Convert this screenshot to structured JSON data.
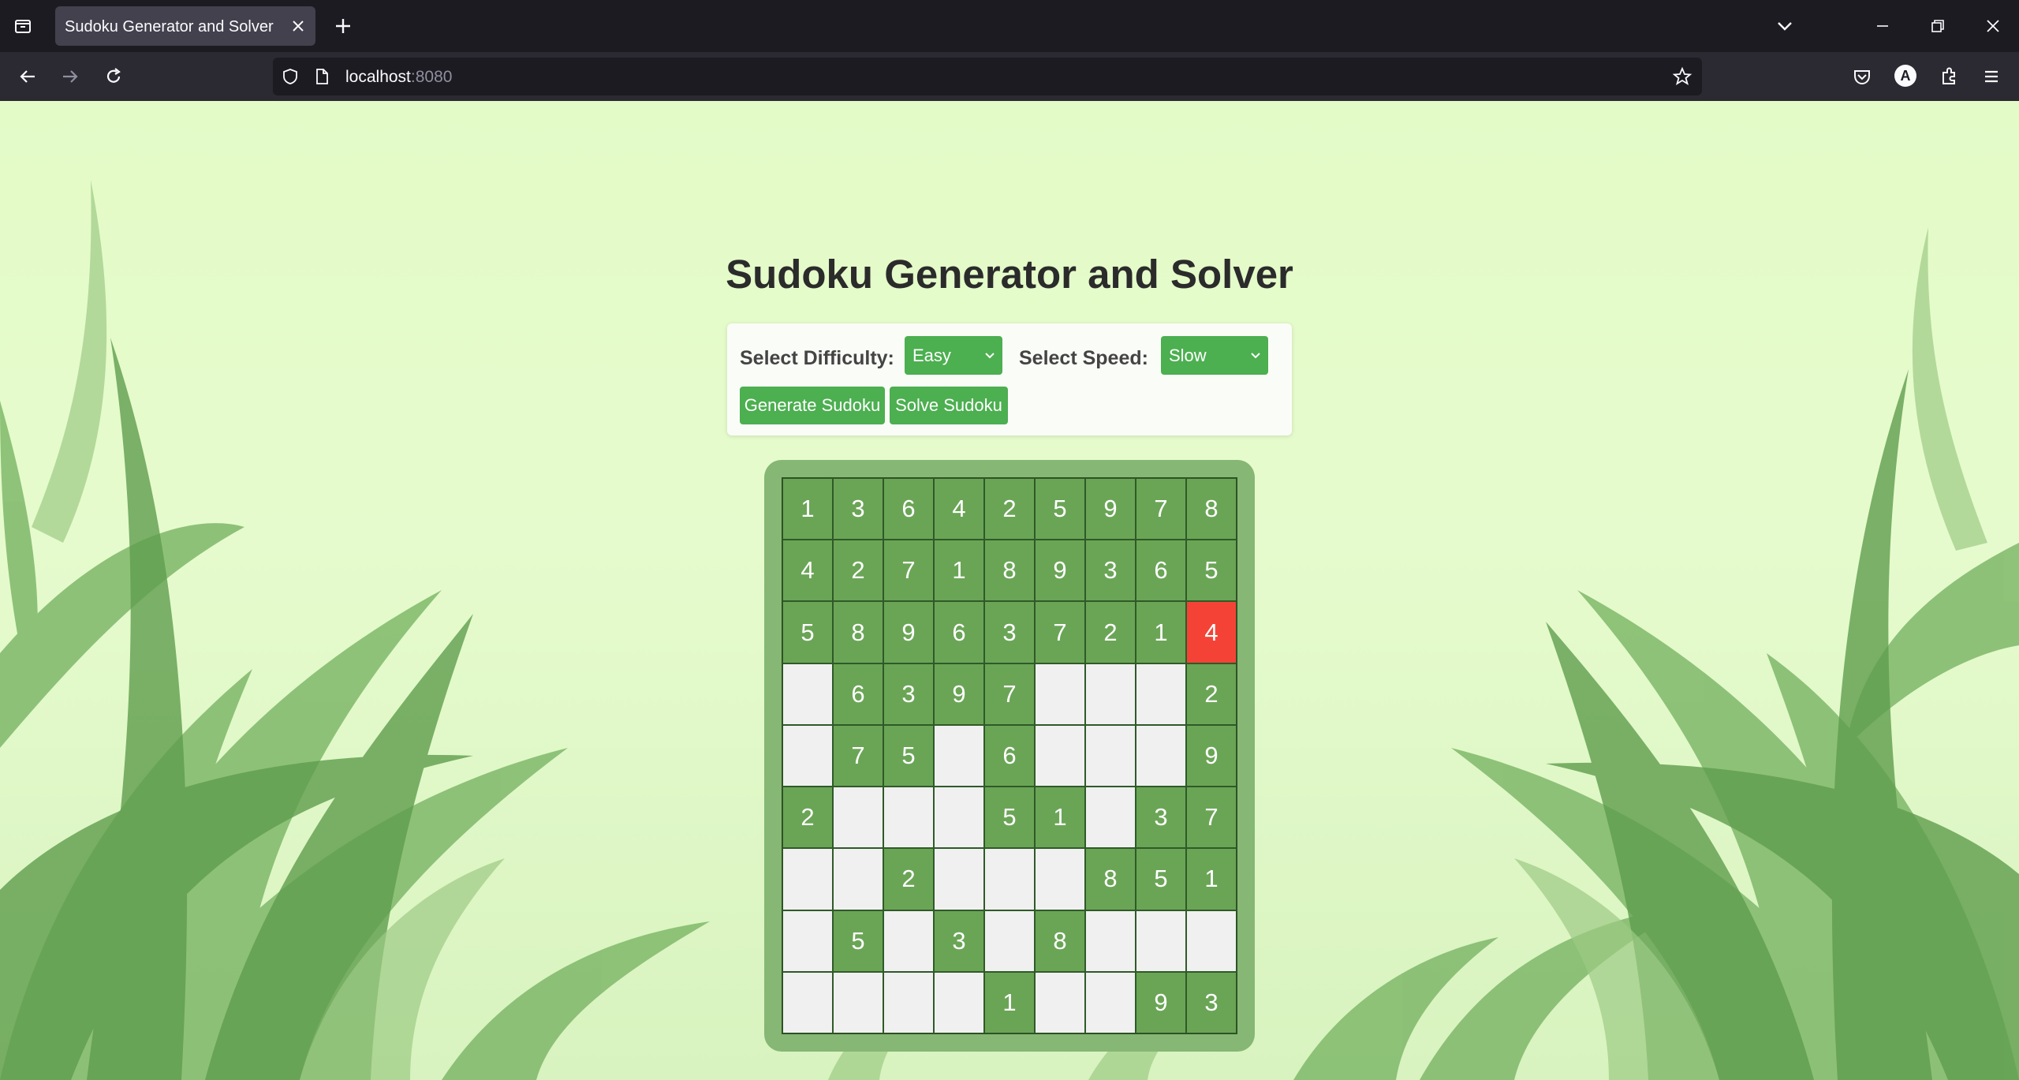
{
  "browser": {
    "tab_title": "Sudoku Generator and Solver",
    "url_host": "localhost",
    "url_port": ":8080",
    "account_initial": "A"
  },
  "page": {
    "title": "Sudoku Generator and Solver",
    "difficulty_label": "Select Difficulty:",
    "difficulty_value": "Easy",
    "speed_label": "Select Speed:",
    "speed_value": "Slow",
    "generate_button": "Generate Sudoku",
    "solve_button": "Solve Sudoku"
  },
  "colors": {
    "accent": "#4caf50",
    "filled_cell": "#6aa556",
    "empty_cell": "#f0f0f0",
    "active_cell": "#f44336",
    "board_frame": "#86b774"
  },
  "board": {
    "active_cell": [
      2,
      8
    ],
    "rows": [
      [
        "1",
        "3",
        "6",
        "4",
        "2",
        "5",
        "9",
        "7",
        "8"
      ],
      [
        "4",
        "2",
        "7",
        "1",
        "8",
        "9",
        "3",
        "6",
        "5"
      ],
      [
        "5",
        "8",
        "9",
        "6",
        "3",
        "7",
        "2",
        "1",
        "4"
      ],
      [
        "",
        "6",
        "3",
        "9",
        "7",
        "",
        "",
        "",
        "2"
      ],
      [
        "",
        "7",
        "5",
        "",
        "6",
        "",
        "",
        "",
        "9"
      ],
      [
        "2",
        "",
        "",
        "",
        "5",
        "1",
        "",
        "3",
        "7"
      ],
      [
        "",
        "",
        "2",
        "",
        "",
        "",
        "8",
        "5",
        "1"
      ],
      [
        "",
        "5",
        "",
        "3",
        "",
        "8",
        "",
        "",
        ""
      ],
      [
        "",
        "",
        "",
        "",
        "1",
        "",
        "",
        "9",
        "3"
      ]
    ]
  }
}
